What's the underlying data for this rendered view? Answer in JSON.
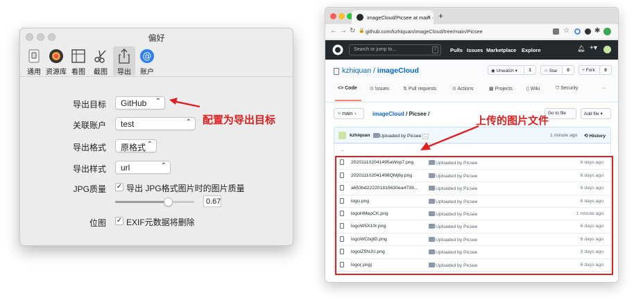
{
  "prefs": {
    "title": "偏好",
    "toolbar": [
      "通用",
      "资源库",
      "看图",
      "截图",
      "导出",
      "账户"
    ],
    "export_target_label": "导出目标",
    "export_target_value": "GitHub",
    "account_label": "关联账户",
    "account_value": "test",
    "format_label": "导出格式",
    "format_value": "原格式",
    "style_label": "导出样式",
    "style_value": "url",
    "jpg_label": "JPG质量",
    "jpg_checkbox_label": "导出 JPG格式图片时的图片质量",
    "jpg_quality": 0.67,
    "jpg_quality_text": "0.67",
    "bitmap_label": "位图",
    "exif_checkbox_label": "EXIF元数据将删除"
  },
  "annotations": {
    "left": "配置为导出目标",
    "right": "上传的图片文件"
  },
  "browser": {
    "tab_title": "imageCloud/Picsee at main · k",
    "new_tab": "+",
    "url": "github.com/kzhiquan/imageCloud/tree/main/Picsee",
    "search_placeholder": "Search or jump to...",
    "search_key": "/",
    "nav": [
      "Pulls",
      "Issues",
      "Marketplace",
      "Explore"
    ],
    "repo_owner": "kzhiquan",
    "repo_sep": " / ",
    "repo_name": "imageCloud",
    "unwatch": "Unwatch",
    "unwatch_count": "1",
    "star": "Star",
    "star_count": "0",
    "fork": "Fork",
    "fork_count": "0",
    "tabs": [
      "Code",
      "Issues",
      "Pull requests",
      "Actions",
      "Projects",
      "Wiki",
      "Security",
      "···"
    ],
    "branch": "main",
    "breadcrumb_repo": "imageCloud",
    "breadcrumb_rest": " / Picsee /",
    "goto_file": "Go to file",
    "add_file": "Add file",
    "commit_user": "kzhiquan",
    "commit_msg": "Uploaded by Picsee",
    "commit_time": "1 minute ago",
    "history": "History",
    "parent_dir": "..",
    "files": [
      {
        "name": "202011102041495aWop7.png",
        "commit": "Uploaded by Picsee",
        "age": "6 days ago"
      },
      {
        "name": "202011102041498QMj8y.png",
        "commit": "Uploaded by Picsee",
        "age": "6 days ago"
      },
      {
        "name": "a653bd222201815630ea4739...",
        "commit": "Uploaded by Picsee",
        "age": "6 days ago"
      },
      {
        "name": "logo.png",
        "commit": "Uploaded by Picsee",
        "age": "6 days ago"
      },
      {
        "name": "logoHMepCK.png",
        "commit": "Uploaded by Picsee",
        "age": "1 minute ago"
      },
      {
        "name": "logoW5X10r.png",
        "commit": "Uploaded by Picsee",
        "age": "6 days ago"
      },
      {
        "name": "logoWCbgtD.png",
        "commit": "Uploaded by Picsee",
        "age": "6 days ago"
      },
      {
        "name": "logoiZ5NJU.png",
        "commit": "Uploaded by Picsee",
        "age": "3 days ago"
      },
      {
        "name": "logo(.png)",
        "commit": "Uploaded by Picsee",
        "age": "6 days ago"
      }
    ]
  },
  "colors": {
    "annotation_red": "#e02020",
    "github_dark": "#24292e",
    "link_blue": "#0366d6"
  }
}
